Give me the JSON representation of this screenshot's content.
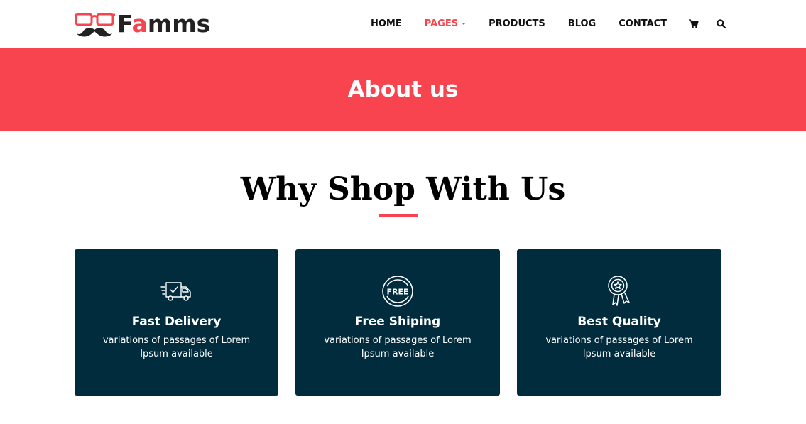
{
  "brand": {
    "logo_prefix": "F",
    "logo_accent": "a",
    "logo_suffix": "mms",
    "accent_color": "#f7444e",
    "dark_color": "#002c3e"
  },
  "nav": {
    "items": [
      {
        "label": "HOME"
      },
      {
        "label": "PAGES"
      },
      {
        "label": "PRODUCTS"
      },
      {
        "label": "BLOG"
      },
      {
        "label": "CONTACT"
      }
    ],
    "active": "PAGES",
    "cart_icon": "cart-icon",
    "search_icon": "search-icon"
  },
  "banner": {
    "title": "About us"
  },
  "section": {
    "title": "Why Shop With Us"
  },
  "cards": [
    {
      "title": "Fast Delivery",
      "description": "variations of passages of Lorem Ipsum available",
      "icon": "delivery-truck-icon"
    },
    {
      "title": "Free Shiping",
      "description": "variations of passages of Lorem Ipsum available",
      "icon": "free-badge-icon"
    },
    {
      "title": "Best Quality",
      "description": "variations of passages of Lorem Ipsum available",
      "icon": "quality-award-icon"
    }
  ]
}
